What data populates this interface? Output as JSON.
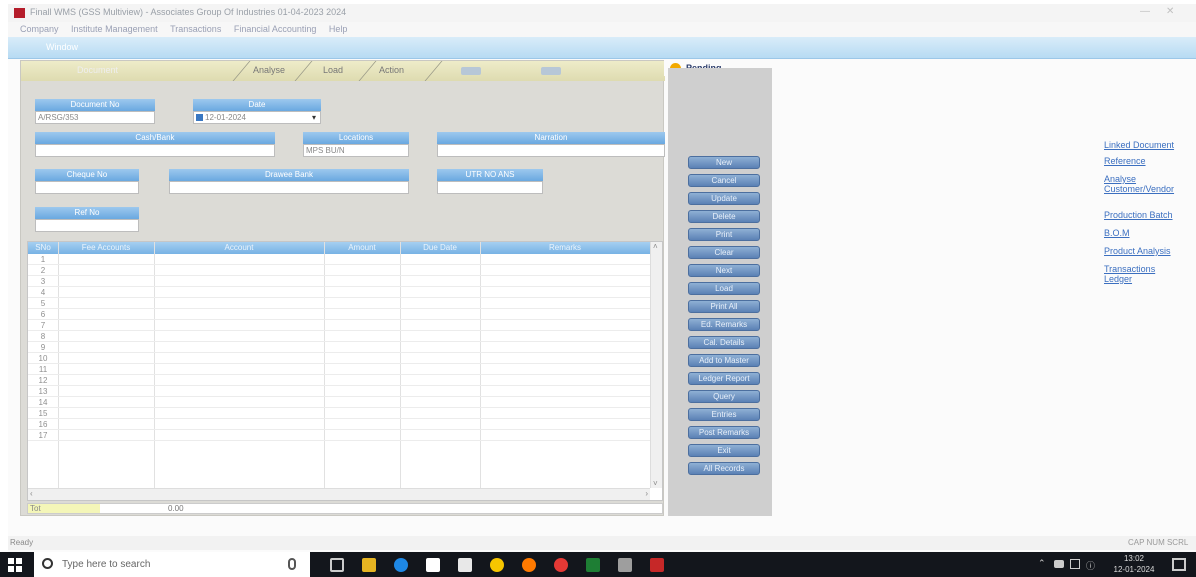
{
  "window": {
    "title": "Finall WMS (GSS Multiview) - Associates Group Of Industries 01-04-2023 2024",
    "controls": [
      "—",
      "☐",
      "✕"
    ]
  },
  "menu": [
    "Company",
    "Institute Management",
    "Transactions",
    "Financial Accounting",
    "Help"
  ],
  "ribbon_tab": "Window",
  "form": {
    "tabs": [
      "Document",
      "Analyse",
      "Load",
      "Action"
    ],
    "document_no": {
      "label": "Document No",
      "value": "A/RSG/353"
    },
    "date": {
      "label": "Date",
      "value": "12-01-2024"
    },
    "cash_bank": {
      "label": "Cash/Bank",
      "value": ""
    },
    "location": {
      "label": "Locations",
      "value": "MPS BU/N"
    },
    "narration": {
      "label": "Narration",
      "value": ""
    },
    "cheque_no": {
      "label": "Cheque No",
      "value": ""
    },
    "drawee_bank": {
      "label": "Drawee Bank",
      "value": ""
    },
    "utr_no": {
      "label": "UTR NO ANS",
      "value": ""
    },
    "ref_no": {
      "label": "Ref No",
      "value": ""
    }
  },
  "grid": {
    "columns": [
      "SNo",
      "Fee Accounts",
      "Account",
      "Amount",
      "Due Date",
      "Remarks"
    ],
    "rows": [
      "1",
      "2",
      "3",
      "4",
      "5",
      "6",
      "7",
      "8",
      "9",
      "10",
      "11",
      "12",
      "13",
      "14",
      "15",
      "16",
      "17"
    ],
    "total_label": "Tot",
    "total_value": "0.00"
  },
  "pending": {
    "label": "Pending"
  },
  "side_buttons": [
    "New",
    "Cancel",
    "Update",
    "Delete",
    "Print",
    "Clear",
    "Next",
    "Load",
    "Print All",
    "Ed. Remarks",
    "Cal. Details",
    "Add to Master",
    "Ledger Report",
    "Query",
    "Entries",
    "Post Remarks",
    "Exit",
    "All Records"
  ],
  "right_links": [
    "Linked Document",
    "Reference",
    "Analyse Customer/Vendor",
    "Production Batch",
    "B.O.M",
    "Product Analysis",
    "Transactions Ledger"
  ],
  "status": {
    "left": "Ready",
    "right": "CAP  NUM  SCRL"
  },
  "taskbar": {
    "search_placeholder": "Type here to search",
    "time": "13:02",
    "date": "12-01-2024"
  },
  "colors": {
    "accent": "#6aa8e0",
    "button": "#5b81b5",
    "link": "#3b6fc0",
    "taskbar": "#13161c"
  }
}
